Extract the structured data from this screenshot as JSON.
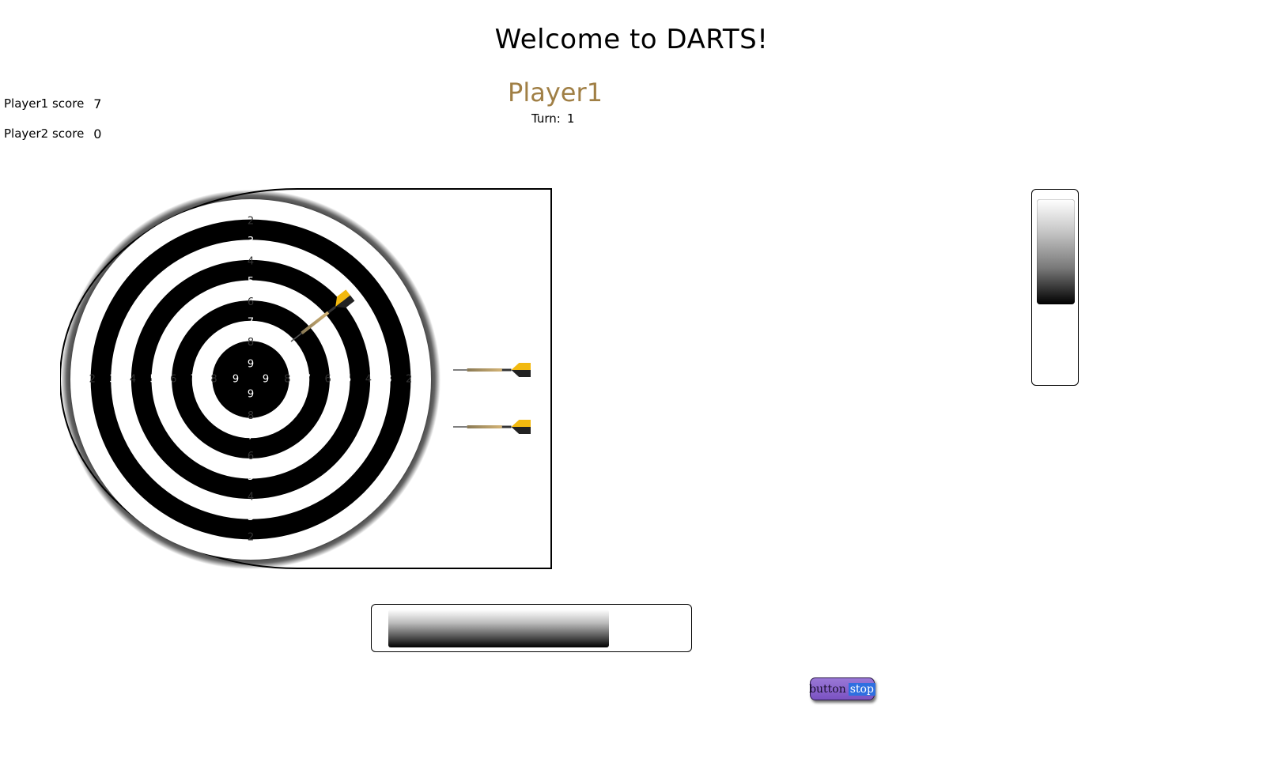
{
  "header": {
    "title": "Welcome to DARTS!"
  },
  "scoreboard": {
    "players": [
      {
        "label": "Player1 score",
        "score": "7"
      },
      {
        "label": "Player2 score",
        "score": "0"
      }
    ]
  },
  "current": {
    "player": "Player1",
    "turn_label": "Turn:",
    "turn_value": "1"
  },
  "board": {
    "ring_numbers": [
      "1",
      "2",
      "3",
      "4",
      "5",
      "6",
      "7",
      "8",
      "9"
    ],
    "darts_remaining": 2,
    "ring_colors": {
      "dark": "#000000",
      "light": "#ffffff"
    },
    "dart_flight_color": "#f2b90f"
  },
  "meters": {
    "vertical_level": 0.59,
    "horizontal_level": 0.74
  },
  "controls": {
    "stop_button_text": "button",
    "stop_button_selected": "stop",
    "stop_button_color": "#8a63cc"
  }
}
